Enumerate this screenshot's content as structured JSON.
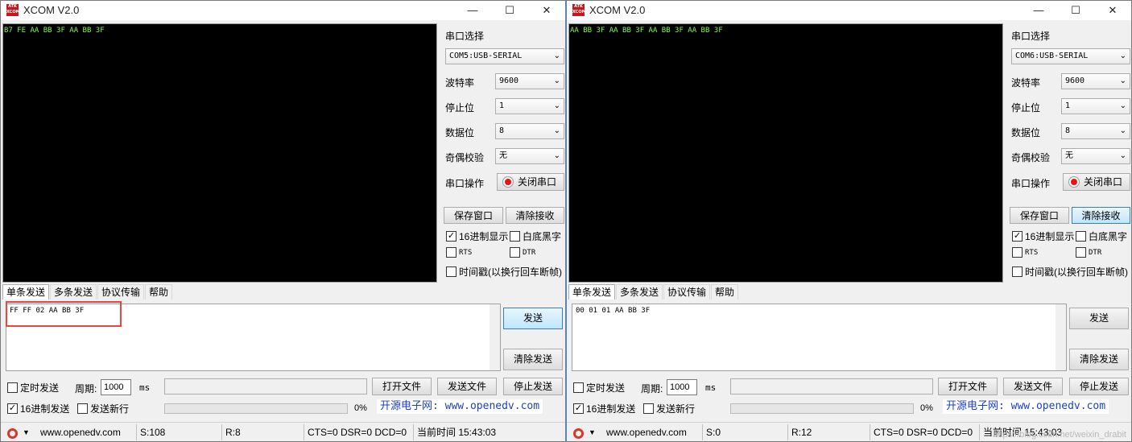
{
  "windows": [
    {
      "title": "XCOM V2.0",
      "receive_text": "B7 FE AA BB 3F AA BB 3F",
      "port_select_label": "串口选择",
      "port_value": "COM5:USB-SERIAL",
      "baud_label": "波特率",
      "baud_value": "9600",
      "stop_label": "停止位",
      "stop_value": "1",
      "data_label": "数据位",
      "data_value": "8",
      "parity_label": "奇偶校验",
      "parity_value": "无",
      "op_label": "串口操作",
      "op_button": "关闭串口",
      "save_btn": "保存窗口",
      "clear_recv_btn": "清除接收",
      "hex_display": "16进制显示",
      "white_bg": "白底黑字",
      "rts": "RTS",
      "dtr": "DTR",
      "timestamp": "时间戳(以换行回车断帧)",
      "tabs": [
        "单条发送",
        "多条发送",
        "协议传输",
        "帮助"
      ],
      "send_text": "FF FF 02 AA BB 3F",
      "send_btn": "发送",
      "clear_send_btn": "清除发送",
      "timed_send": "定时发送",
      "period_label": "周期:",
      "period_value": "1000",
      "ms": "ms",
      "open_file": "打开文件",
      "send_file": "发送文件",
      "stop_send": "停止发送",
      "hex_send": "16进制发送",
      "send_newline": "发送新行",
      "progress": "0%",
      "site_link": "开源电子网: www.openedv.com",
      "status": {
        "site": "www.openedv.com",
        "sent": "S:108",
        "recv": "R:8",
        "lines": "CTS=0 DSR=0 DCD=0",
        "time": "当前时间 15:43:03"
      }
    },
    {
      "title": "XCOM V2.0",
      "receive_text": "AA BB 3F AA BB 3F AA BB 3F AA BB 3F",
      "port_select_label": "串口选择",
      "port_value": "COM6:USB-SERIAL",
      "baud_label": "波特率",
      "baud_value": "9600",
      "stop_label": "停止位",
      "stop_value": "1",
      "data_label": "数据位",
      "data_value": "8",
      "parity_label": "奇偶校验",
      "parity_value": "无",
      "op_label": "串口操作",
      "op_button": "关闭串口",
      "save_btn": "保存窗口",
      "clear_recv_btn": "清除接收",
      "hex_display": "16进制显示",
      "white_bg": "白底黑字",
      "rts": "RTS",
      "dtr": "DTR",
      "timestamp": "时间戳(以换行回车断帧)",
      "tabs": [
        "单条发送",
        "多条发送",
        "协议传输",
        "帮助"
      ],
      "send_text": "00 01 01 AA BB 3F",
      "send_btn": "发送",
      "clear_send_btn": "清除发送",
      "timed_send": "定时发送",
      "period_label": "周期:",
      "period_value": "1000",
      "ms": "ms",
      "open_file": "打开文件",
      "send_file": "发送文件",
      "stop_send": "停止发送",
      "hex_send": "16进制发送",
      "send_newline": "发送新行",
      "progress": "0%",
      "site_link": "开源电子网: www.openedv.com",
      "status": {
        "site": "www.openedv.com",
        "sent": "S:0",
        "recv": "R:12",
        "lines": "CTS=0 DSR=0 DCD=0",
        "time": "当前时间 15:43:03"
      }
    }
  ],
  "watermark": "https://blog.csdn.net/weixin_drabit",
  "colors": {
    "receive_bg": "#000000",
    "receive_text": "#7fff3f",
    "highlight": "#e8473f",
    "link": "#1c3fc7"
  }
}
